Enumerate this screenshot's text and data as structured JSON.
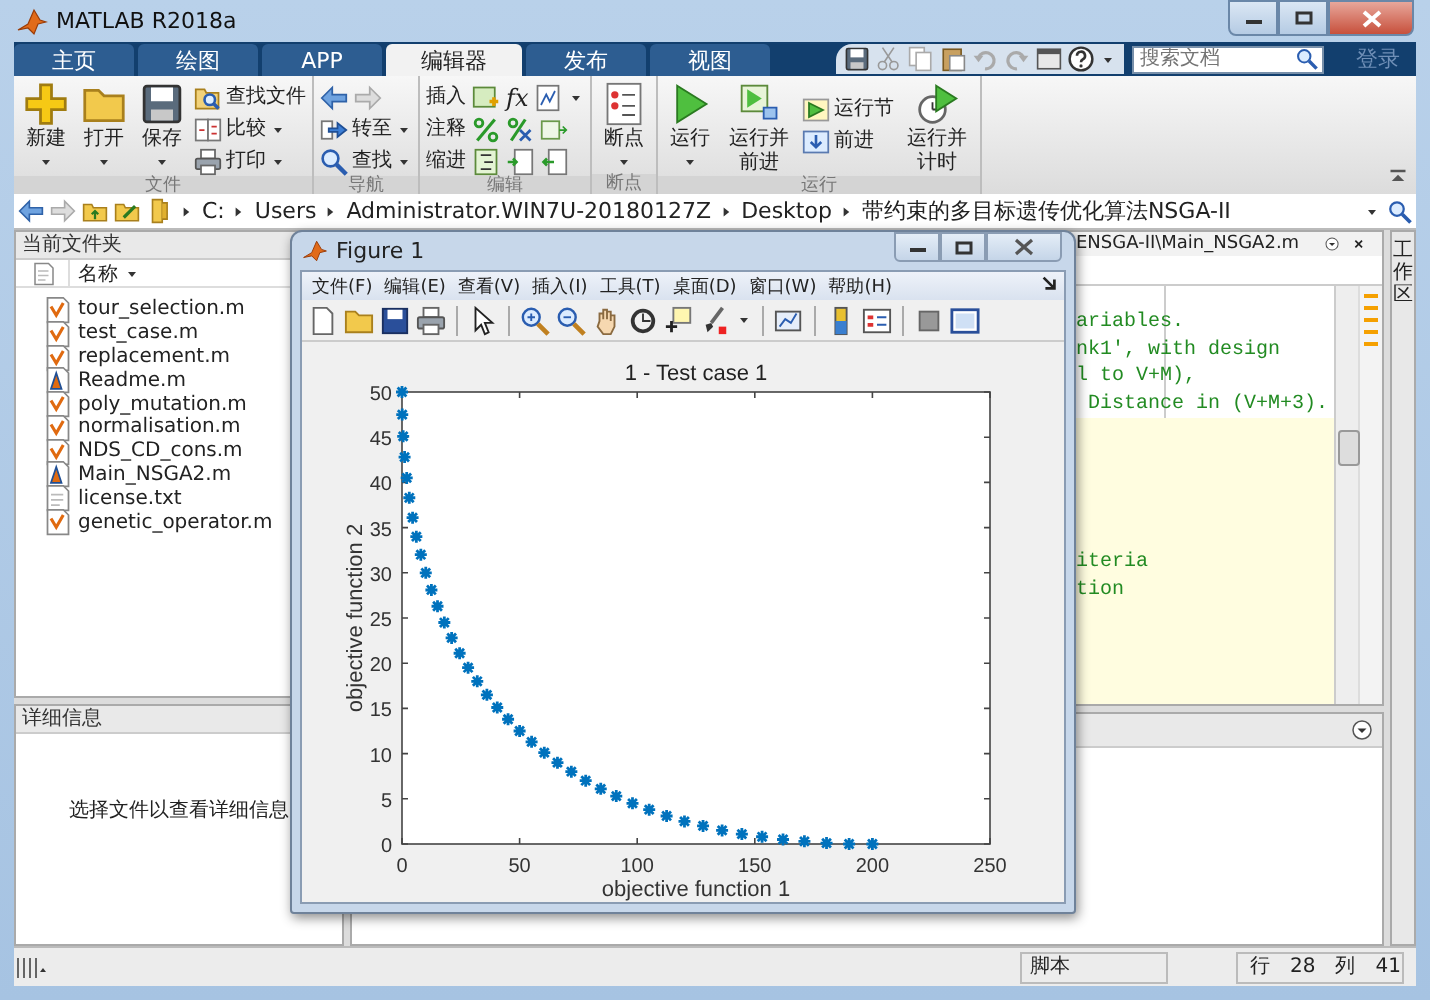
{
  "window": {
    "title": "MATLAB R2018a"
  },
  "tabs": [
    {
      "label": "主页",
      "selected": false
    },
    {
      "label": "绘图",
      "selected": false
    },
    {
      "label": "APP",
      "selected": false
    },
    {
      "label": "编辑器",
      "selected": true
    },
    {
      "label": "发布",
      "selected": false
    },
    {
      "label": "视图",
      "selected": false
    }
  ],
  "search": {
    "placeholder": "搜索文档"
  },
  "login": "登录",
  "ribbon": {
    "file": {
      "label": "文件",
      "new": "新建",
      "open": "打开",
      "save": "保存",
      "find_files": "查找文件",
      "compare": "比较",
      "print": "打印"
    },
    "navigate": {
      "label": "导航",
      "goto": "转至",
      "find": "查找"
    },
    "edit": {
      "label": "编辑",
      "insert": "插入",
      "fx": "fx",
      "comment": "注释",
      "indent": "缩进"
    },
    "breakpoints": {
      "label": "断点",
      "breakpoints": "断点"
    },
    "run": {
      "label": "运行",
      "run": "运行",
      "run_advance": "运行并前进",
      "run_section": "运行节",
      "advance": "前进",
      "run_time": "运行并计时"
    }
  },
  "address_bar": {
    "segments": [
      "C:",
      "Users",
      "Administrator.WIN7U-20180127Z",
      "Desktop",
      "带约束的多目标遗传优化算法NSGA-II"
    ]
  },
  "current_folder": {
    "title": "当前文件夹",
    "column": "名称",
    "files": [
      {
        "name": "tour_selection.m",
        "kind": "function"
      },
      {
        "name": "test_case.m",
        "kind": "function"
      },
      {
        "name": "replacement.m",
        "kind": "function"
      },
      {
        "name": "Readme.m",
        "kind": "script"
      },
      {
        "name": "poly_mutation.m",
        "kind": "function"
      },
      {
        "name": "normalisation.m",
        "kind": "function"
      },
      {
        "name": "NDS_CD_cons.m",
        "kind": "function"
      },
      {
        "name": "Main_NSGA2.m",
        "kind": "script"
      },
      {
        "name": "license.txt",
        "kind": "text"
      },
      {
        "name": "genetic_operator.m",
        "kind": "function"
      }
    ]
  },
  "details": {
    "title": "详细信息",
    "message": "选择文件以查看详细信息"
  },
  "editor": {
    "tab_title": "ENSGA-II\\Main_NSGA2.m",
    "cells": [
      {
        "highlighted": false,
        "lines": [
          "ariables.",
          "nk1', with design",
          "l to V+M),",
          " Distance in (V+M+3)."
        ]
      },
      {
        "highlighted": true,
        "lines": [
          "iteria",
          "tion"
        ]
      }
    ]
  },
  "workspace_tab": "工作区",
  "status_bar": {
    "type": "脚本",
    "row_label": "行",
    "row": "28",
    "col_label": "列",
    "col": "41"
  },
  "figure": {
    "title": "Figure 1",
    "menu": [
      "文件(F)",
      "编辑(E)",
      "查看(V)",
      "插入(I)",
      "工具(T)",
      "桌面(D)",
      "窗口(W)",
      "帮助(H)"
    ],
    "chart_data": {
      "type": "scatter",
      "title": "1 - Test case 1",
      "xlabel": "objective function 1",
      "ylabel": "objective function 2",
      "x": [
        0,
        0.1,
        0.5,
        1.1,
        2,
        3.1,
        4.5,
        6.1,
        8,
        10.1,
        12.5,
        15.1,
        18,
        21.1,
        24.5,
        28.1,
        32,
        36.1,
        40.5,
        45.1,
        50,
        55.1,
        60.5,
        66.1,
        72,
        78.1,
        84.5,
        91.1,
        98,
        105.1,
        112.5,
        120.1,
        128,
        136.1,
        144.5,
        153.1,
        162,
        171.1,
        180.5,
        190.1,
        200
      ],
      "series": [
        {
          "color": "#0072bd",
          "values": [
            50,
            47.5,
            45.1,
            42.8,
            40.5,
            38.3,
            36.1,
            34,
            32,
            30,
            28.1,
            26.3,
            24.5,
            22.8,
            21.1,
            19.5,
            18,
            16.5,
            15.1,
            13.8,
            12.5,
            11.3,
            10.1,
            9,
            8,
            7,
            6.1,
            5.3,
            4.5,
            3.8,
            3.1,
            2.5,
            2,
            1.5,
            1.1,
            0.8,
            0.5,
            0.3,
            0.1,
            0,
            0
          ]
        }
      ],
      "xlim": [
        0,
        250
      ],
      "ylim": [
        0,
        50
      ],
      "xticks": [
        0,
        50,
        100,
        150,
        200,
        250
      ],
      "yticks": [
        0,
        5,
        10,
        15,
        20,
        25,
        30,
        35,
        40,
        45,
        50
      ]
    }
  }
}
